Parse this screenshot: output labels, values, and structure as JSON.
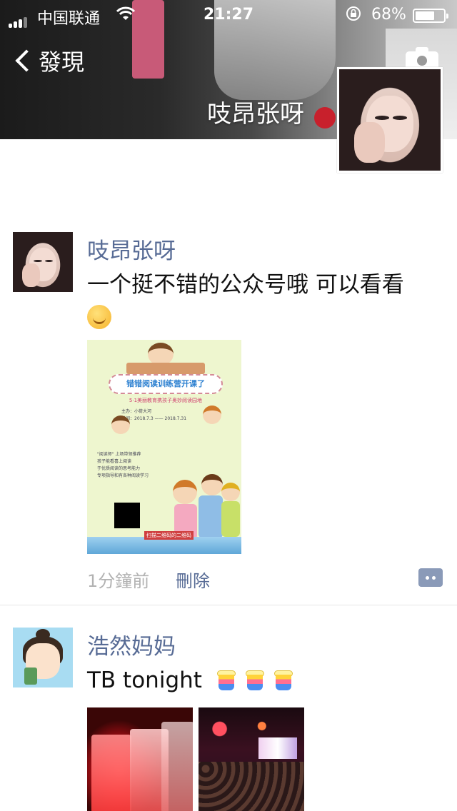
{
  "status_bar": {
    "carrier": "中国联通",
    "time": "21:27",
    "battery_percent_text": "68%",
    "battery_level": 0.68
  },
  "nav": {
    "back_label": "發現",
    "camera_icon": "camera-icon"
  },
  "profile": {
    "name": "吱昂张呀"
  },
  "posts": [
    {
      "author": "吱昂张呀",
      "text": "一个挺不错的公众号哦 可以看看",
      "emoji": "smile-emoji",
      "image": {
        "banner": "错错阅读训练营开课了",
        "subtitle": "5·1美丽教育携孩子奥妙阅读园地",
        "info_lines": [
          "主办：小荷大河",
          "时间：2018.7.3 —— 2018.7.31"
        ],
        "list_lines": [
          "\"阅读师\" 上场带领推荐",
          "孩子能看喜上阅读",
          "于优质阅读的思考能力",
          "专项指导和有各种阅读学习"
        ],
        "qr_label": "扫描二维码的二维码"
      },
      "time_ago": "1分鐘前",
      "delete_label": "刪除"
    },
    {
      "author": "浩然妈妈",
      "text": "TB tonight",
      "emoji_count": 3
    }
  ],
  "colors": {
    "link_name": "#576b95",
    "meta_gray": "#b2b2b2"
  }
}
